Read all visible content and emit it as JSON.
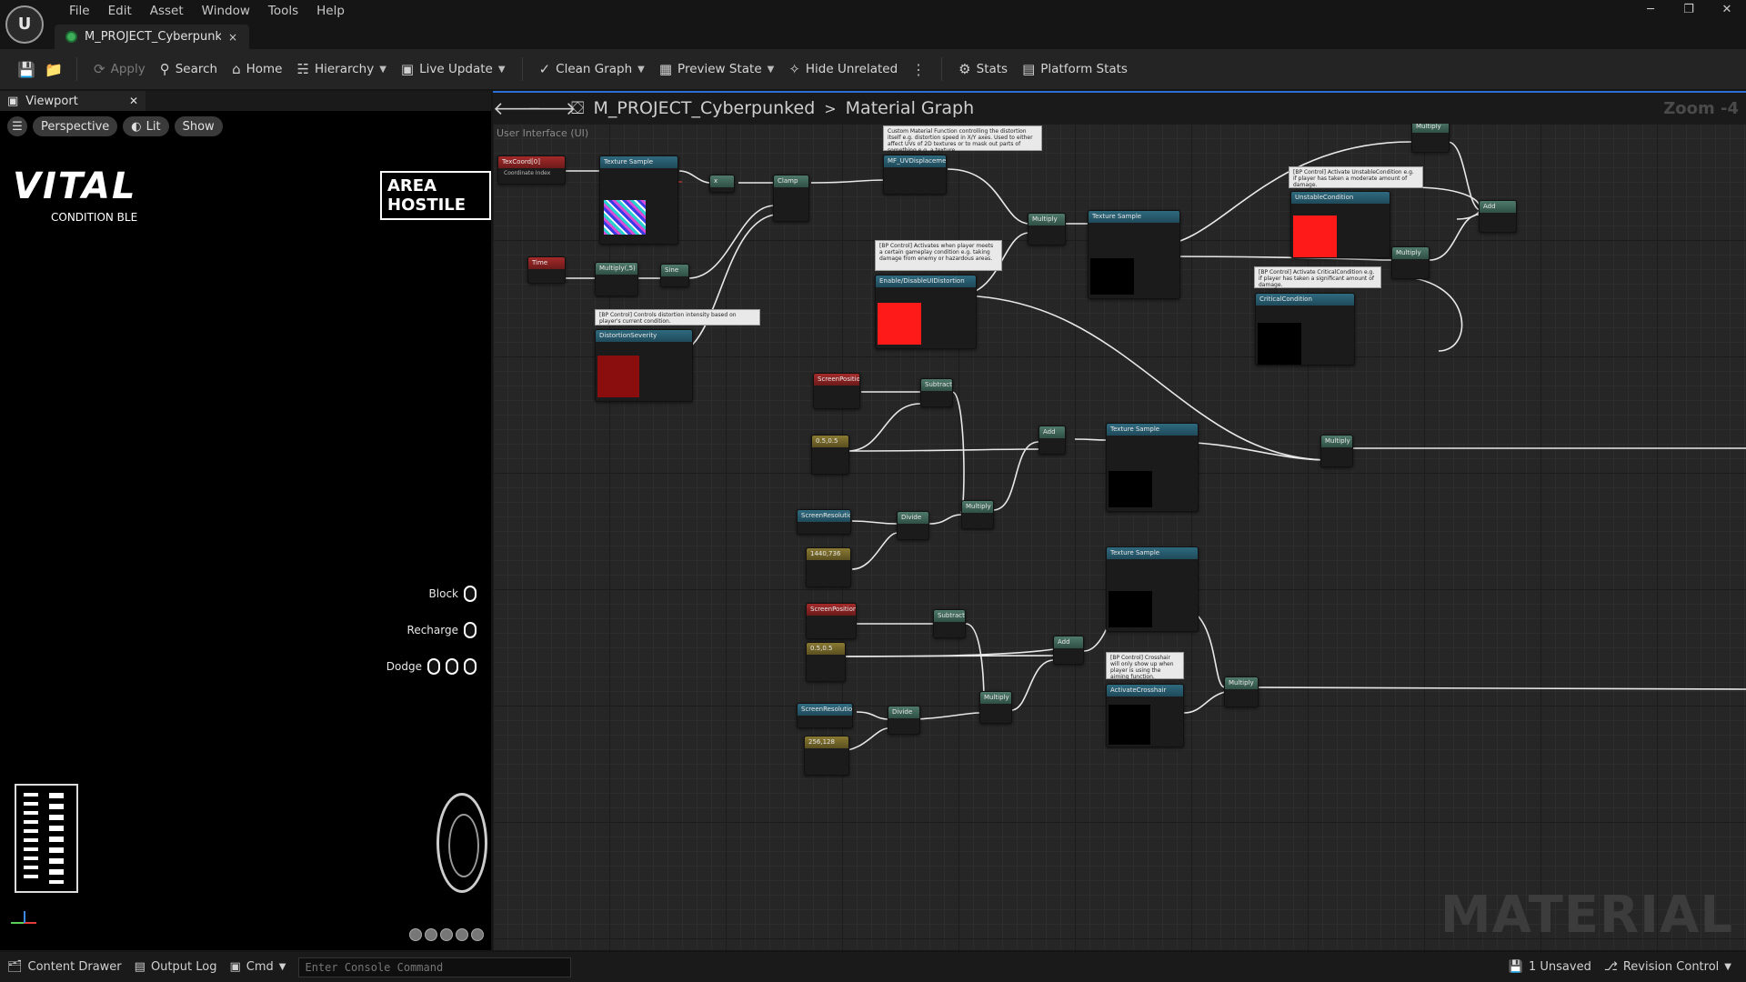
{
  "menu": {
    "items": [
      "File",
      "Edit",
      "Asset",
      "Window",
      "Tools",
      "Help"
    ]
  },
  "asset_tab": {
    "label": "M_PROJECT_Cyberpunk...",
    "close": "×"
  },
  "window_controls": [
    "─",
    "❐",
    "✕"
  ],
  "toolbar": {
    "apply": "Apply",
    "search": "Search",
    "home": "Home",
    "hierarchy": "Hierarchy",
    "live_update": "Live Update",
    "clean_graph": "Clean Graph",
    "preview_state": "Preview State",
    "hide_unrelated": "Hide Unrelated",
    "stats": "Stats",
    "platform_stats": "Platform Stats"
  },
  "viewport": {
    "tab_label": "Viewport",
    "perspective": "Perspective",
    "lit": "Lit",
    "show": "Show",
    "hud": {
      "vital": "VITAL",
      "condition": "CONDITION BLE",
      "hostile": "AREA HOSTILE",
      "rows": [
        "Block",
        "Recharge",
        "Dodge"
      ]
    }
  },
  "graph": {
    "breadcrumb_asset": "M_PROJECT_Cyberpunked",
    "breadcrumb_sep": ">",
    "breadcrumb_graph": "Material Graph",
    "zoom": "Zoom -4",
    "domain_label": "User Interface (UI)",
    "watermark": "MATERIAL",
    "nodes": {
      "texcoord": "TexCoord[0]",
      "texcoord_pin": "Coordinate Index",
      "texsample1": "Texture Sample",
      "time": "Time",
      "multiply1": "Multiply(,5)",
      "sine": "Sine",
      "x": "x",
      "clamp": "Clamp",
      "mf_uv": "MF_UVDisplacement",
      "distortion_severity": "DistortionSeverity",
      "enable_distortion": "Enable/DisableUIDistortion",
      "multiply2": "Multiply",
      "texsample2": "Texture Sample",
      "unstable": "UnstableCondition",
      "critical": "CriticalCondition",
      "multiply_tr1": "Multiply",
      "multiply_tr2": "Multiply",
      "add_tr": "Add",
      "screenpos1": "ScreenPosition",
      "subtract1": "Subtract",
      "const1": "0.5,0.5",
      "add1": "Add",
      "texsample3": "Texture Sample",
      "multiply_mid": "Multiply",
      "screenres1": "ScreenResolution",
      "divide1": "Divide",
      "multiply3": "Multiply",
      "const2": "1440,736",
      "screenpos2": "ScreenPosition",
      "subtract2": "Subtract",
      "const3": "0.5,0.5",
      "add2": "Add",
      "texsample4": "Texture Sample",
      "screenres2": "ScreenResolution",
      "divide2": "Divide",
      "multiply4": "Multiply",
      "const4": "256,128",
      "activate_crosshair": "ActivateCrosshair",
      "multiply_br": "Multiply"
    },
    "comments": {
      "c_mf": "Custom Material Function controlling the distortion itself e.g. distortion speed in X/Y axes. Used to either affect UVs of 2D textures or to mask out parts of something e.g. a texture.",
      "c_enable": "[BP Control] Activates when player meets a certain gameplay condition e.g. taking damage from enemy or hazardous areas.",
      "c_severity": "[BP Control] Controls distortion intensity based on player's current condition.",
      "c_unstable": "[BP Control] Activate UnstableCondition e.g. if player has taken a moderate amount of damage.",
      "c_critical": "[BP Control] Activate CriticalCondition e.g. if player has taken a significant amount of damage.",
      "c_crosshair": "[BP Control] Crosshair will only show up when player is using the aiming function."
    }
  },
  "statusbar": {
    "content_drawer": "Content Drawer",
    "output_log": "Output Log",
    "cmd": "Cmd",
    "console_placeholder": "Enter Console Command",
    "unsaved": "1 Unsaved",
    "revision_control": "Revision Control"
  },
  "colors": {
    "accent": "#2b6fd6",
    "red_param": "#ff1a1a",
    "dark_red_param": "#8b0e0e"
  }
}
